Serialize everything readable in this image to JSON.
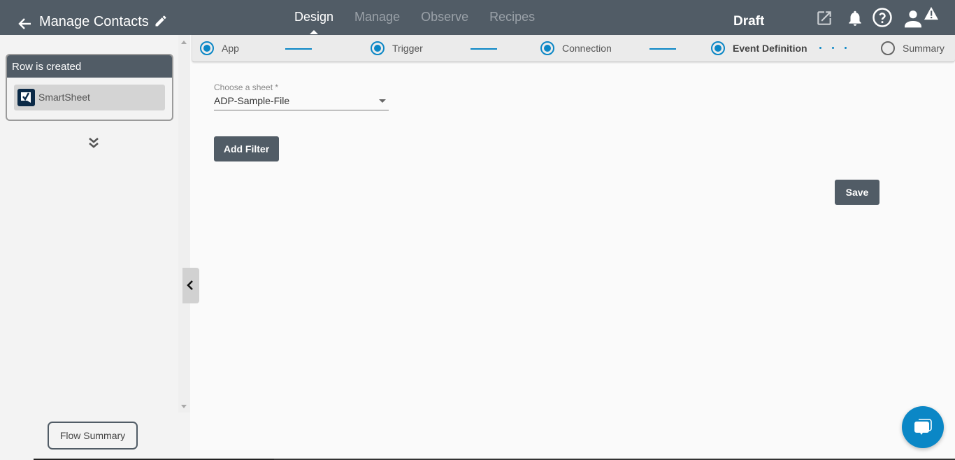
{
  "header": {
    "title": "Manage Contacts",
    "nav_tabs": [
      {
        "label": "Design",
        "active": true
      },
      {
        "label": "Manage",
        "active": false
      },
      {
        "label": "Observe",
        "active": false
      },
      {
        "label": "Recipes",
        "active": false
      }
    ],
    "status": "Draft",
    "icons": [
      "back-arrow-icon",
      "edit-icon",
      "external-link-icon",
      "bell-icon",
      "help-icon",
      "user-icon",
      "warning-icon"
    ]
  },
  "sidebar": {
    "trigger_card": {
      "title": "Row is created",
      "app_name": "SmartSheet"
    },
    "flow_summary_label": "Flow Summary"
  },
  "stepper": {
    "steps": [
      {
        "label": "App",
        "state": "done"
      },
      {
        "label": "Trigger",
        "state": "done"
      },
      {
        "label": "Connection",
        "state": "done"
      },
      {
        "label": "Event Definition",
        "state": "current"
      },
      {
        "label": "Summary",
        "state": "pending"
      }
    ]
  },
  "form": {
    "sheet_label": "Choose a sheet *",
    "sheet_value": "ADP-Sample-File",
    "add_filter_label": "Add Filter",
    "save_label": "Save"
  },
  "colors": {
    "header_bg": "#515c66",
    "accent": "#0b87c6",
    "smartsheet_logo": "#0b2a47"
  }
}
